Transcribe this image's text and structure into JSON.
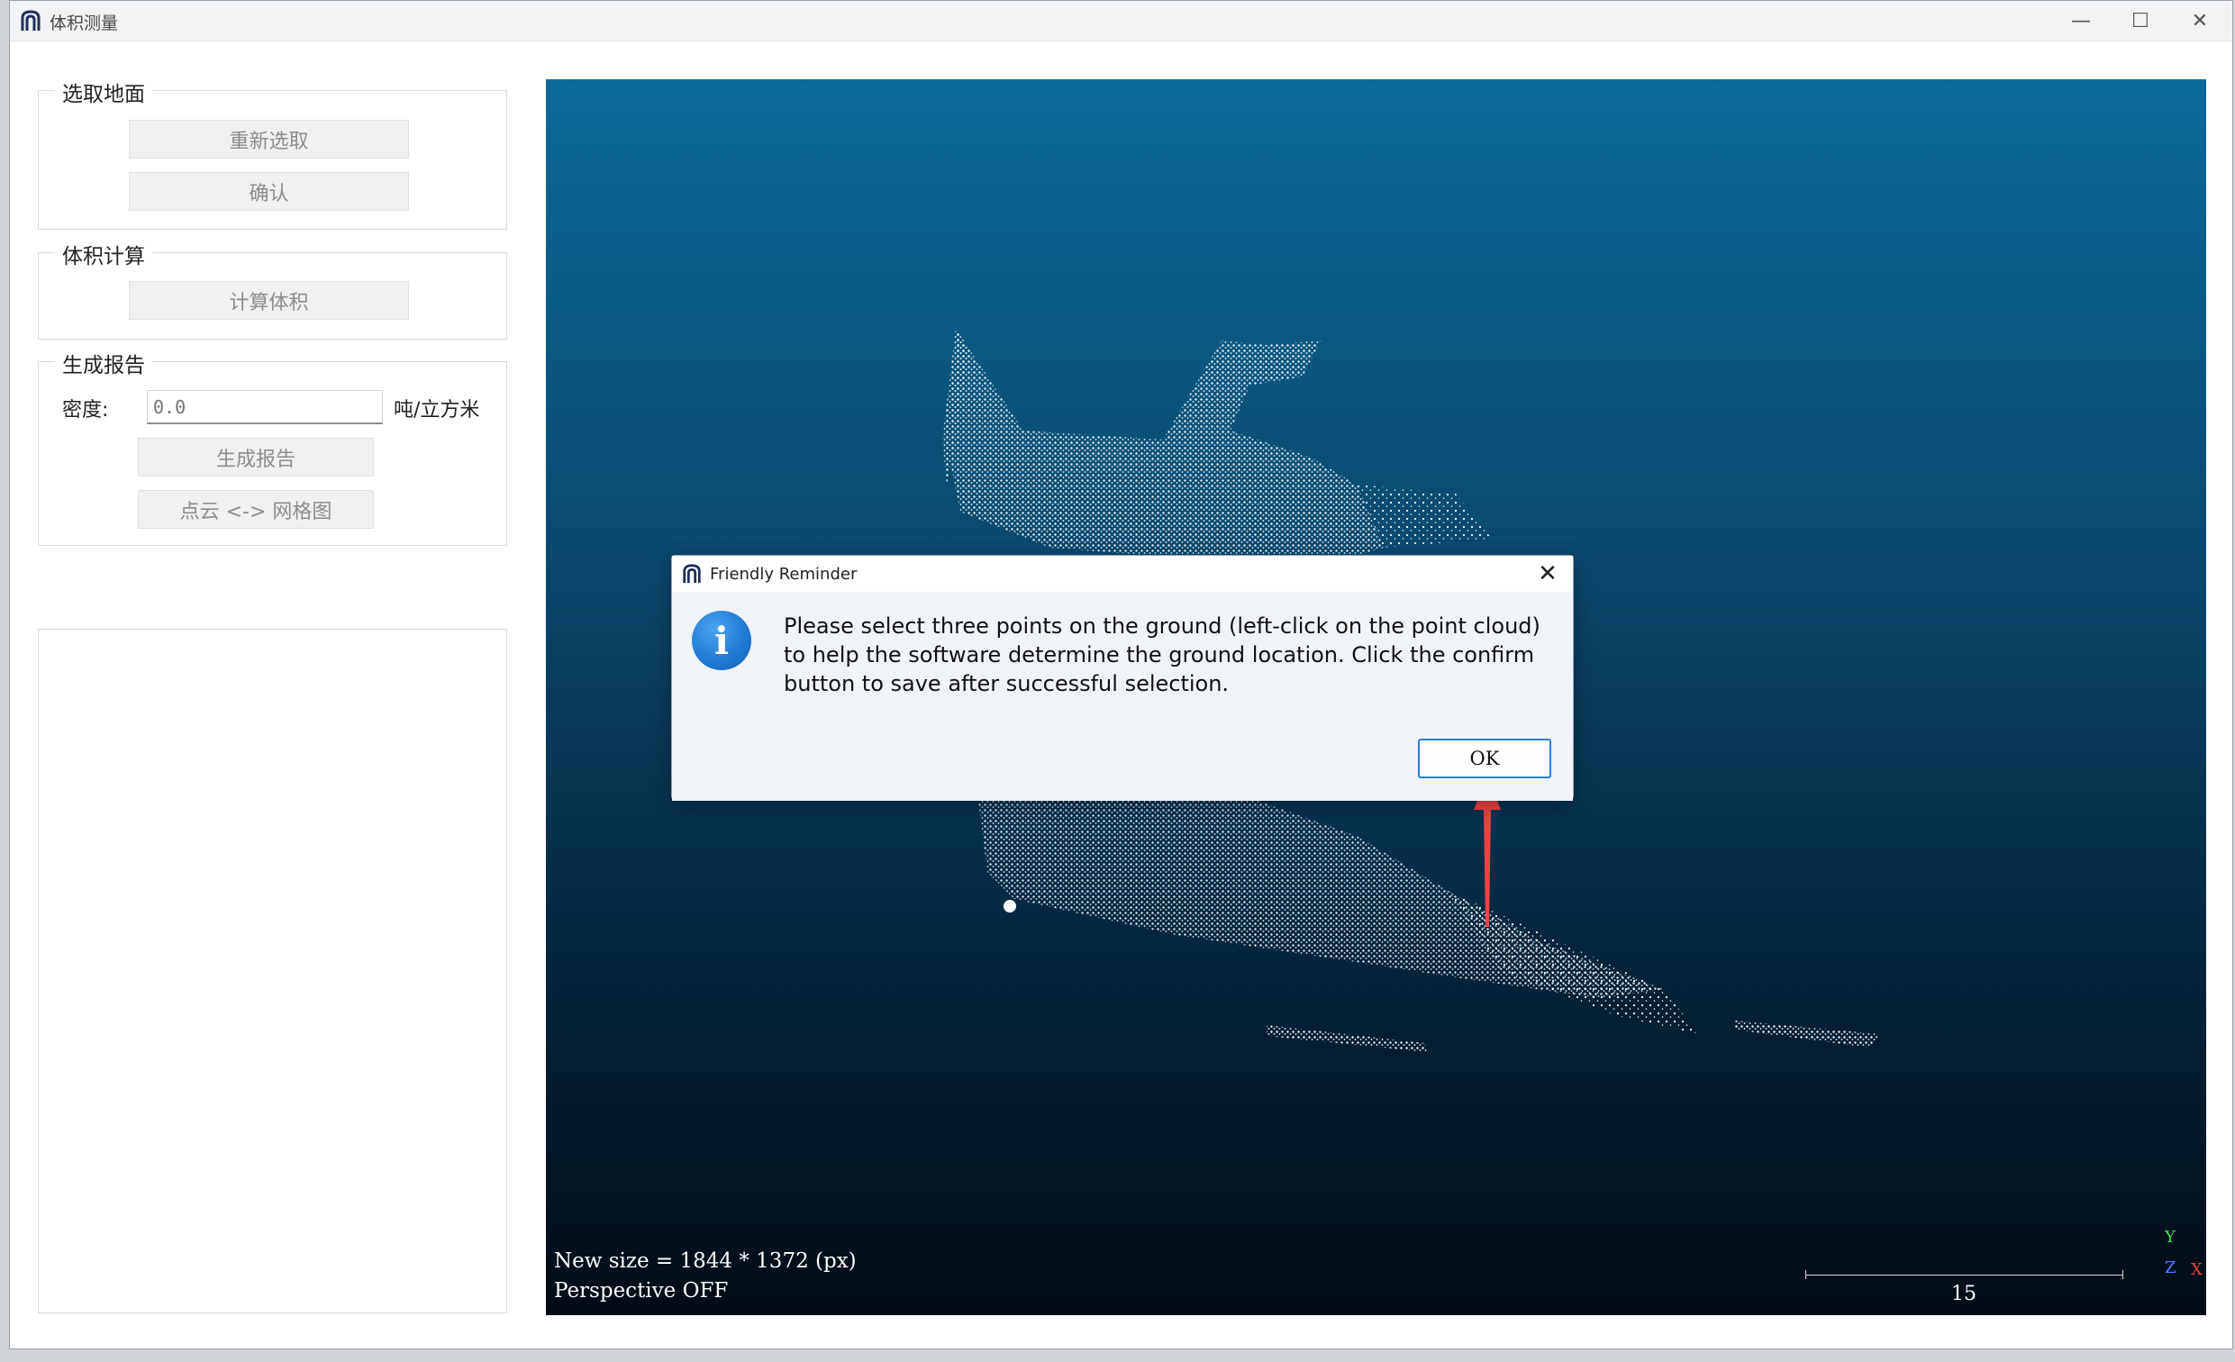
{
  "window": {
    "title": "体积测量",
    "minimize_glyph": "—",
    "maximize_glyph": "☐",
    "close_glyph": "✕"
  },
  "panel": {
    "ground": {
      "title": "选取地面",
      "reselect_label": "重新选取",
      "confirm_label": "确认"
    },
    "volume": {
      "title": "体积计算",
      "compute_label": "计算体积"
    },
    "report": {
      "title": "生成报告",
      "density_label": "密度:",
      "density_placeholder": "0.0",
      "density_unit": "吨/立方米",
      "generate_label": "生成报告",
      "toggle_label": "点云 <-> 网格图"
    }
  },
  "viewport": {
    "size_text": "New size = 1844 * 1372 (px)",
    "perspective_text": "Perspective OFF",
    "scale_value": "15",
    "axis_y": "Y",
    "axis_z": "Z",
    "axis_x": "X",
    "colors": {
      "top": "#0b6a9b",
      "bottom": "#020b14",
      "points": "#ffffff"
    }
  },
  "dialog": {
    "title": "Friendly Reminder",
    "close_glyph": "✕",
    "icon": "info-icon",
    "message": "Please select three points on the ground (left-click on the point cloud) to help the software determine the ground location. Click the confirm button to save after successful selection.",
    "ok_label": "OK",
    "accent": "#2f7fd4"
  },
  "annotation": {
    "arrow_color": "#e84444"
  }
}
